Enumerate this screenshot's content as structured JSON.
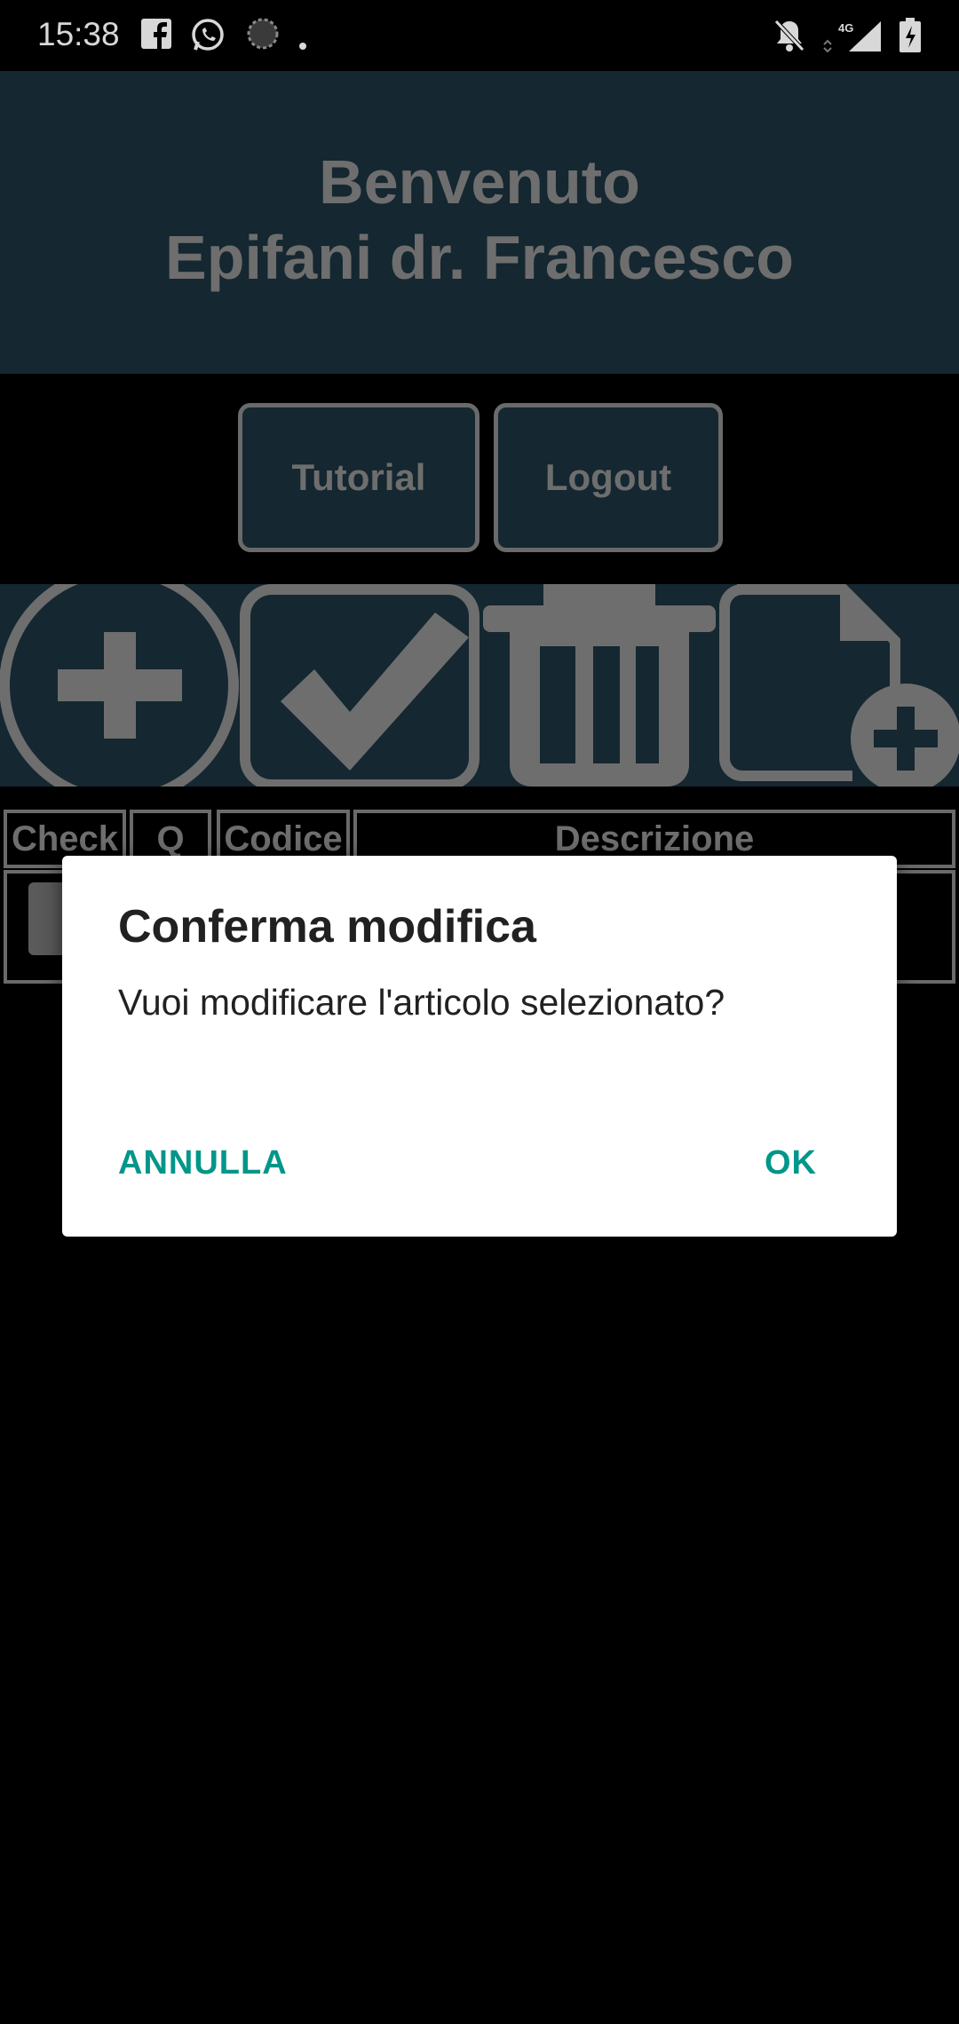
{
  "status_bar": {
    "time": "15:38",
    "left_icons": [
      "facebook-icon",
      "whatsapp-icon",
      "sync-icon",
      "dot-icon"
    ],
    "right_icons": [
      "notifications-off-icon",
      "signal-4g-icon",
      "battery-charging-icon"
    ],
    "network_label": "4G"
  },
  "header": {
    "line1": "Benvenuto",
    "line2": "Epifani dr. Francesco"
  },
  "buttons": {
    "tutorial": "Tutorial",
    "logout": "Logout"
  },
  "toolbar": {
    "icons": [
      "add-circle-icon",
      "check-box-icon",
      "trash-icon",
      "new-document-icon"
    ]
  },
  "table": {
    "headers": [
      "Check",
      "Q",
      "Codice",
      "Descrizione"
    ]
  },
  "dialog": {
    "title": "Conferma modifica",
    "message": "Vuoi modificare l'articolo selezionato?",
    "cancel_label": "ANNULLA",
    "ok_label": "OK"
  },
  "colors": {
    "header_bg": "#152730",
    "muted_text": "#6e6e6e",
    "dialog_accent": "#00968a"
  }
}
